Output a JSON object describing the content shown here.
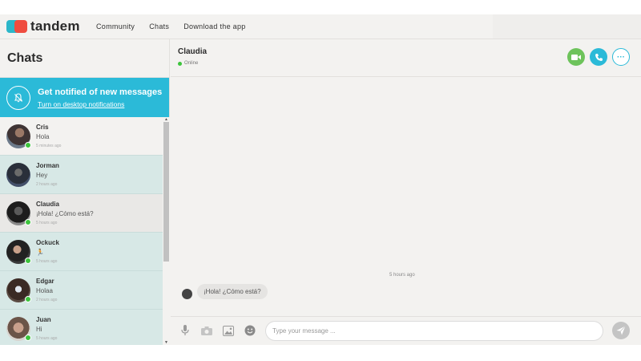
{
  "nav": {
    "brand": "tandem",
    "links": [
      "Community",
      "Chats",
      "Download the app"
    ]
  },
  "sidebar": {
    "title": "Chats",
    "notify": {
      "title": "Get notified of new messages",
      "link": "Turn on desktop notifications"
    },
    "chats": [
      {
        "name": "Cris",
        "message": "Hola",
        "time": "5 minutes ago"
      },
      {
        "name": "Jorman",
        "message": "Hey",
        "time": "2 hours ago"
      },
      {
        "name": "Claudia",
        "message": "¡Hola! ¿Cómo está?",
        "time": "5 hours ago"
      },
      {
        "name": "Ockuck",
        "message": "🏃",
        "time": "5 hours ago"
      },
      {
        "name": "Edgar",
        "message": "Holaa",
        "time": "2 hours ago"
      },
      {
        "name": "Juan",
        "message": "Hi",
        "time": "5 hours ago"
      }
    ]
  },
  "conversation": {
    "name": "Claudia",
    "status": "Online",
    "date_separator": "5 hours ago",
    "messages": [
      {
        "text": "¡Hola! ¿Cómo está?"
      }
    ],
    "composer_placeholder": "Type your message ..."
  },
  "icons": {
    "video_call": "video-camera-icon",
    "audio_call": "phone-icon",
    "more": "more-options-icon",
    "mic": "microphone-icon",
    "camera": "camera-icon",
    "gallery": "image-icon",
    "emoji": "emoji-icon",
    "send": "send-icon",
    "notify": "bell-off-icon"
  },
  "colors": {
    "accent": "#2bbad8",
    "online": "#3cc43c",
    "video": "#6dc35b",
    "logo_teal": "#2bb6c9",
    "logo_red": "#ef4c3f",
    "unread_bg": "#d7e8e6"
  }
}
